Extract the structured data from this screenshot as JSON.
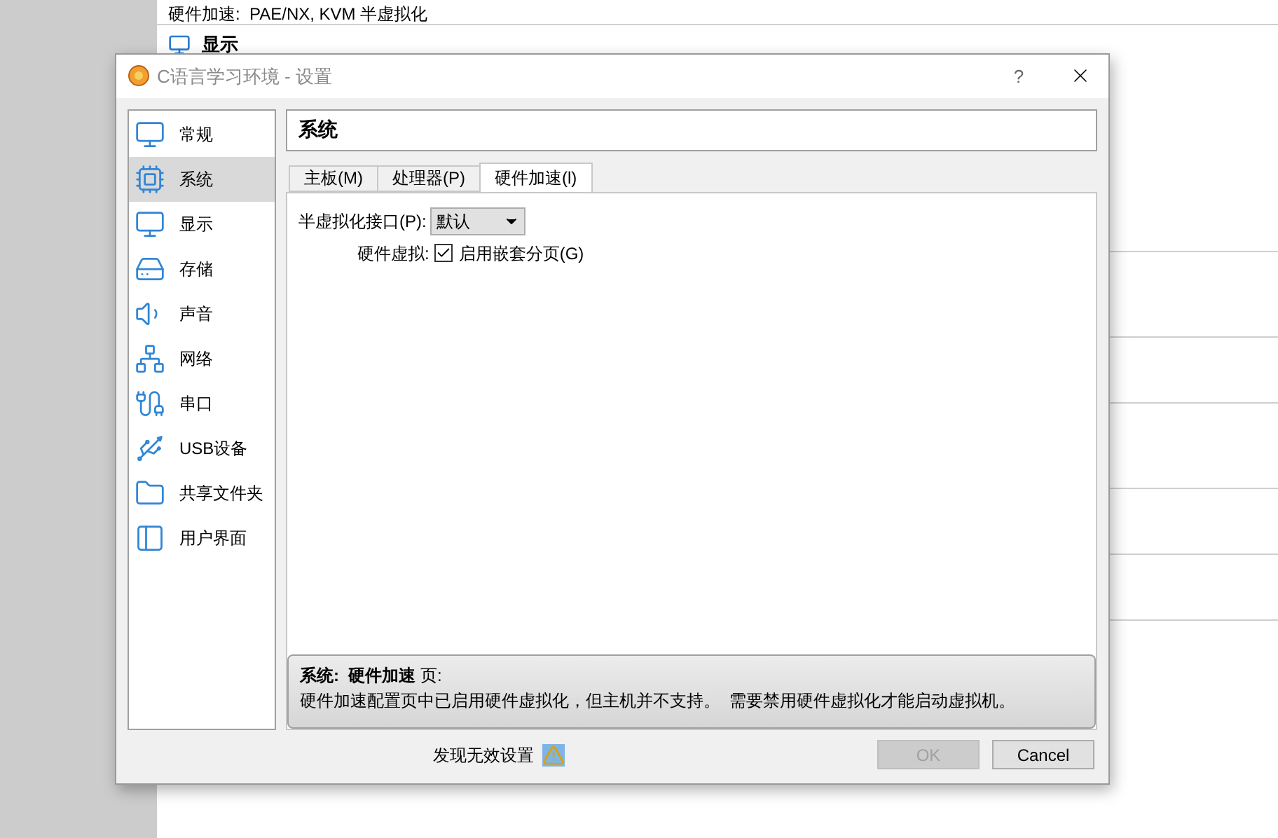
{
  "background": {
    "lines": [
      "硬件加速:  PAE/NX, KVM 半虚拟化"
    ],
    "section": "显示"
  },
  "dialog": {
    "title": "C语言学习环境 - 设置",
    "help": "?",
    "sidebar": {
      "items": [
        {
          "label": "常规",
          "kind": "general",
          "selected": false
        },
        {
          "label": "系统",
          "kind": "system",
          "selected": true
        },
        {
          "label": "显示",
          "kind": "display",
          "selected": false
        },
        {
          "label": "存储",
          "kind": "storage",
          "selected": false
        },
        {
          "label": "声音",
          "kind": "audio",
          "selected": false
        },
        {
          "label": "网络",
          "kind": "network",
          "selected": false
        },
        {
          "label": "串口",
          "kind": "serial",
          "selected": false
        },
        {
          "label": "USB设备",
          "kind": "usb",
          "selected": false
        },
        {
          "label": "共享文件夹",
          "kind": "folder",
          "selected": false
        },
        {
          "label": "用户界面",
          "kind": "ui",
          "selected": false
        }
      ]
    },
    "header": "系统",
    "tabs": [
      {
        "label": "主板(M)",
        "selected": false
      },
      {
        "label": "处理器(P)",
        "selected": false
      },
      {
        "label": "硬件加速(l)",
        "selected": true
      }
    ],
    "paravirt": {
      "label": "半虚拟化接口(P):",
      "value": "默认"
    },
    "hw_virt": {
      "label": "硬件虚拟:",
      "option": "启用嵌套分页(G)",
      "checked": true
    },
    "message": {
      "title": "**系统:  硬件加速** 页:",
      "body": "硬件加速配置页中已启用硬件虚拟化，但主机并不支持。  需要禁用硬件虚拟化才能启动虚拟机。"
    },
    "footer": {
      "warning": "发现无效设置",
      "buttons": [
        {
          "label": "OK",
          "disabled": true
        },
        {
          "label": "Cancel",
          "disabled": false
        }
      ]
    }
  }
}
